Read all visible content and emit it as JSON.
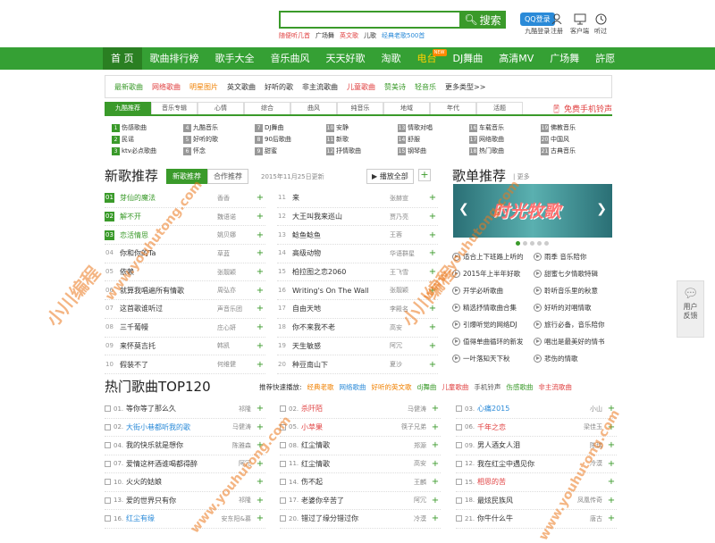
{
  "search": {
    "placeholder": "",
    "button": "搜索",
    "hot": [
      "随便听几首",
      "广场舞",
      "英文歌",
      "儿歌",
      "经典老歌500首"
    ]
  },
  "top_links": {
    "qq": "QQ登录",
    "qq_sub": "九酷登录",
    "register": "注册",
    "client": "客户端",
    "listen": "听过"
  },
  "nav": [
    {
      "label": "首 页"
    },
    {
      "label": "歌曲排行榜"
    },
    {
      "label": "歌手大全"
    },
    {
      "label": "音乐曲风"
    },
    {
      "label": "天天好歌"
    },
    {
      "label": "淘歌"
    },
    {
      "label": "电台",
      "badge": "NEW"
    },
    {
      "label": "DJ舞曲"
    },
    {
      "label": "高清MV"
    },
    {
      "label": "广场舞"
    },
    {
      "label": "許愿"
    }
  ],
  "cats": [
    "最新歌曲",
    "网络歌曲",
    "明星图片",
    "英文歌曲",
    "好听的歌",
    "非主流歌曲",
    "儿童歌曲",
    "赞美诗",
    "轻音乐",
    "更多类型>>"
  ],
  "tabs": [
    "九酷推荐",
    "音乐专辑",
    "心情",
    "综合",
    "曲风",
    "纯音乐",
    "地域",
    "年代",
    "活题"
  ],
  "phone": "免费手机铃声",
  "radio": [
    [
      "1",
      "伤感歌曲"
    ],
    [
      "4",
      "九酷音乐"
    ],
    [
      "7",
      "DJ舞曲"
    ],
    [
      "10",
      "安静"
    ],
    [
      "13",
      "情歌对唱"
    ],
    [
      "16",
      "车载音乐"
    ],
    [
      "19",
      "佛教音乐"
    ],
    [
      "2",
      "民谣"
    ],
    [
      "5",
      "好听的歌"
    ],
    [
      "8",
      "90后歌曲"
    ],
    [
      "11",
      "新歌"
    ],
    [
      "14",
      "舒服"
    ],
    [
      "17",
      "网络歌曲"
    ],
    [
      "20",
      "中国风"
    ],
    [
      "3",
      "ktv必点歌曲"
    ],
    [
      "6",
      "怀念"
    ],
    [
      "9",
      "甜蜜"
    ],
    [
      "12",
      "抒情歌曲"
    ],
    [
      "15",
      "钢琴曲"
    ],
    [
      "18",
      "热门歌曲"
    ],
    [
      "21",
      "古典音乐"
    ]
  ],
  "new_songs": {
    "title": "新歌推荐",
    "tab1": "新歌推荐",
    "tab2": "合作推荐",
    "date": "2015年11月25日更新",
    "play_all": "播放全部",
    "left": [
      [
        "01",
        "芽仙的魔法",
        "香香"
      ],
      [
        "02",
        "解不开",
        "魏语诺"
      ],
      [
        "03",
        "恋活情思",
        "姚贝娜"
      ],
      [
        "04",
        "你和你的Ta",
        "草蓝"
      ],
      [
        "05",
        "依赖",
        "张靓颖"
      ],
      [
        "06",
        "就算我唱遍所有情歌",
        "周弘亦"
      ],
      [
        "07",
        "这首歌谁听过",
        "声音乐团"
      ],
      [
        "08",
        "三千葡幔",
        "庄心妍"
      ],
      [
        "09",
        "来怀莫吉托",
        "韩凯"
      ],
      [
        "10",
        "假装不了",
        "何维健"
      ]
    ],
    "right": [
      [
        "11",
        "来",
        "张赫宣"
      ],
      [
        "12",
        "大王叫我来巡山",
        "贾乃亮"
      ],
      [
        "13",
        "鲶鱼鲶鱼",
        "王蓉"
      ],
      [
        "14",
        "高级动物",
        "华语群星"
      ],
      [
        "15",
        "柏拉图之恋2060",
        "王飞雪"
      ],
      [
        "16",
        "Writing's On The Wall",
        "张靓颖"
      ],
      [
        "17",
        "自由天地",
        "李殿名"
      ],
      [
        "18",
        "你不来我不老",
        "高安"
      ],
      [
        "19",
        "天生敏感",
        "阿冗"
      ],
      [
        "20",
        "种豆南山下",
        "夏沙"
      ]
    ]
  },
  "gedan": {
    "title": "歌单推荐",
    "more": "| 更多",
    "banner": "时光牧歌",
    "items": [
      "适合上下班路上听的",
      "雨季 音乐陪你",
      "2015年上半年好歌",
      "甜蜜七夕情歌特辑",
      "开学必听歌曲",
      "聆听音乐里的秋意",
      "精选抒情歌曲合集",
      "好听的对唱情歌",
      "引爆听觉的网络DJ",
      "旅行必备，音乐陪你",
      "值得单曲循环的新发",
      "唱出是最美好的情书",
      "一叶落知天下秋",
      "悲伤的情歌"
    ]
  },
  "top120": {
    "title": "热门歌曲TOP120",
    "quick_label": "推荐快速播放:",
    "quick": [
      {
        "t": "经典老歌",
        "c": "orange"
      },
      {
        "t": "网络歌曲",
        "c": "green"
      },
      {
        "t": "好听的英文歌",
        "c": "orange"
      },
      {
        "t": "dj舞曲",
        "c": "green"
      },
      {
        "t": "儿童歌曲",
        "c": "red"
      },
      {
        "t": "手机铃声",
        "c": "gray"
      },
      {
        "t": "伤感歌曲",
        "c": "green"
      },
      {
        "t": "非主流歌曲",
        "c": "red"
      }
    ],
    "col1": [
      [
        "01.",
        "等你等了那么久",
        "祁隆",
        ""
      ],
      [
        "02.",
        "大街小巷都听我的歌",
        "马健涛",
        "g"
      ],
      [
        "04.",
        "我的快乐就是想你",
        "陈雅森",
        ""
      ],
      [
        "07.",
        "爱情这杯酒谁喝都得醉",
        "阿冗",
        ""
      ],
      [
        "10.",
        "火火的姑娘",
        "",
        ""
      ],
      [
        "13.",
        "爱的世界只有你",
        "祁隆",
        ""
      ],
      [
        "16.",
        "红尘有缘",
        "安东阳&慕",
        "g"
      ]
    ],
    "col2": [
      [
        "02.",
        "杀阡陌",
        "马健涛",
        "r"
      ],
      [
        "05.",
        "小苹果",
        "筷子兄弟",
        "r"
      ],
      [
        "08.",
        "红尘情歌",
        "郑源",
        ""
      ],
      [
        "11.",
        "红尘情歌",
        "高安",
        ""
      ],
      [
        "14.",
        "伤不起",
        "王麟",
        ""
      ],
      [
        "17.",
        "老婆你辛苦了",
        "阿冗",
        ""
      ],
      [
        "20.",
        "错过了缘分错过你",
        "冷漠",
        ""
      ]
    ],
    "col3": [
      [
        "03.",
        "心痛2015",
        "小山",
        "g"
      ],
      [
        "06.",
        "千年之恋",
        "梁佳玉",
        "r"
      ],
      [
        "09.",
        "男人酒女人泪",
        "陈瑞",
        ""
      ],
      [
        "12.",
        "我在红尘中遇见你",
        "冷漠",
        ""
      ],
      [
        "15.",
        "相思的苦",
        "",
        "r"
      ],
      [
        "18.",
        "最炫民族风",
        "凤凰传奇",
        ""
      ],
      [
        "21.",
        "你牛什么牛",
        "唐古",
        ""
      ]
    ]
  },
  "side": {
    "label": "用户反馈"
  },
  "watermark": {
    "text1": "小川编程",
    "text2": "www.youhutong.com"
  },
  "colors": {
    "brand": "#35a034",
    "nav_active": "#2a7f22",
    "accent_red": "#e04040",
    "accent_orange": "#f08000"
  }
}
